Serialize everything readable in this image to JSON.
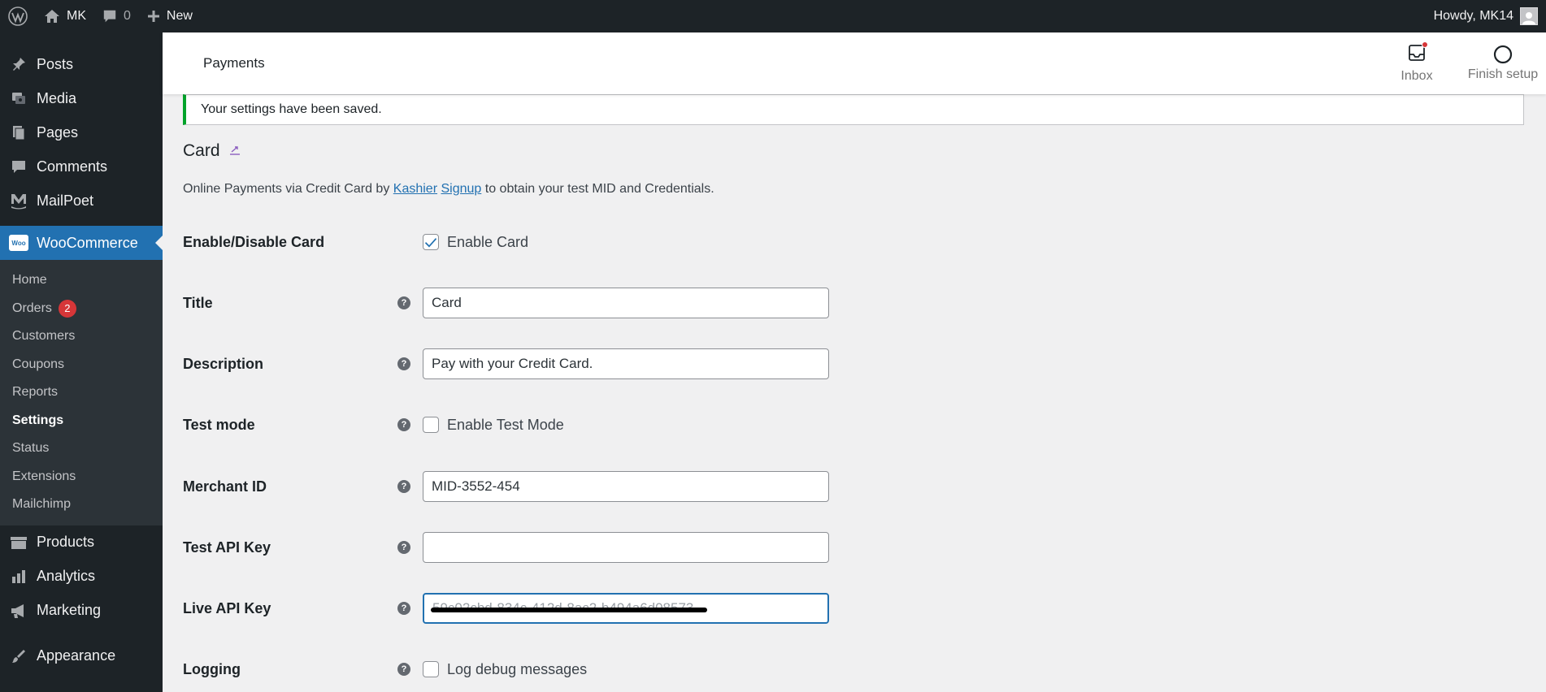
{
  "admin_bar": {
    "site_name": "MK",
    "comments_count": "0",
    "new_label": "New",
    "greeting": "Howdy, MK14"
  },
  "sidebar": {
    "top_items": [
      {
        "label": "Posts",
        "icon": "pin-icon"
      },
      {
        "label": "Media",
        "icon": "media-icon"
      },
      {
        "label": "Pages",
        "icon": "pages-icon"
      },
      {
        "label": "Comments",
        "icon": "comment-icon"
      },
      {
        "label": "MailPoet",
        "icon": "mailpoet-icon"
      }
    ],
    "woocommerce": {
      "label": "WooCommerce",
      "badge": "Woo"
    },
    "submenu": [
      {
        "label": "Home"
      },
      {
        "label": "Orders",
        "count": "2"
      },
      {
        "label": "Customers"
      },
      {
        "label": "Coupons"
      },
      {
        "label": "Reports"
      },
      {
        "label": "Settings"
      },
      {
        "label": "Status"
      },
      {
        "label": "Extensions"
      },
      {
        "label": "Mailchimp"
      }
    ],
    "bottom_items": [
      {
        "label": "Products",
        "icon": "products-icon"
      },
      {
        "label": "Analytics",
        "icon": "analytics-icon"
      },
      {
        "label": "Marketing",
        "icon": "megaphone-icon"
      },
      {
        "label": "Appearance",
        "icon": "brush-icon"
      }
    ]
  },
  "header": {
    "title": "Payments",
    "inbox_label": "Inbox",
    "finish_setup_label": "Finish setup"
  },
  "notice": {
    "text": "Your settings have been saved."
  },
  "section": {
    "title": "Card",
    "desc_prefix": "Online Payments via Credit Card by ",
    "link_kashier": "Kashier",
    "link_signup": "Signup",
    "desc_suffix": " to obtain your test MID and Credentials."
  },
  "form": {
    "enable": {
      "label": "Enable/Disable Card",
      "checkbox_label": "Enable Card",
      "checked": true
    },
    "title": {
      "label": "Title",
      "value": "Card"
    },
    "description": {
      "label": "Description",
      "value": "Pay with your Credit Card."
    },
    "test_mode": {
      "label": "Test mode",
      "checkbox_label": "Enable Test Mode",
      "checked": false
    },
    "merchant_id": {
      "label": "Merchant ID",
      "value": "MID-3552-454"
    },
    "test_api_key": {
      "label": "Test API Key",
      "value": ""
    },
    "live_api_key": {
      "label": "Live API Key",
      "value": "59c02cbd-834c-412d-8ac2-b494a6d08573"
    },
    "logging": {
      "label": "Logging",
      "checkbox_label": "Log debug messages",
      "checked": false
    }
  },
  "colors": {
    "accent": "#2271b1",
    "sidebar_bg": "#1d2327",
    "notice_success": "#00a32a",
    "badge": "#d63638"
  }
}
